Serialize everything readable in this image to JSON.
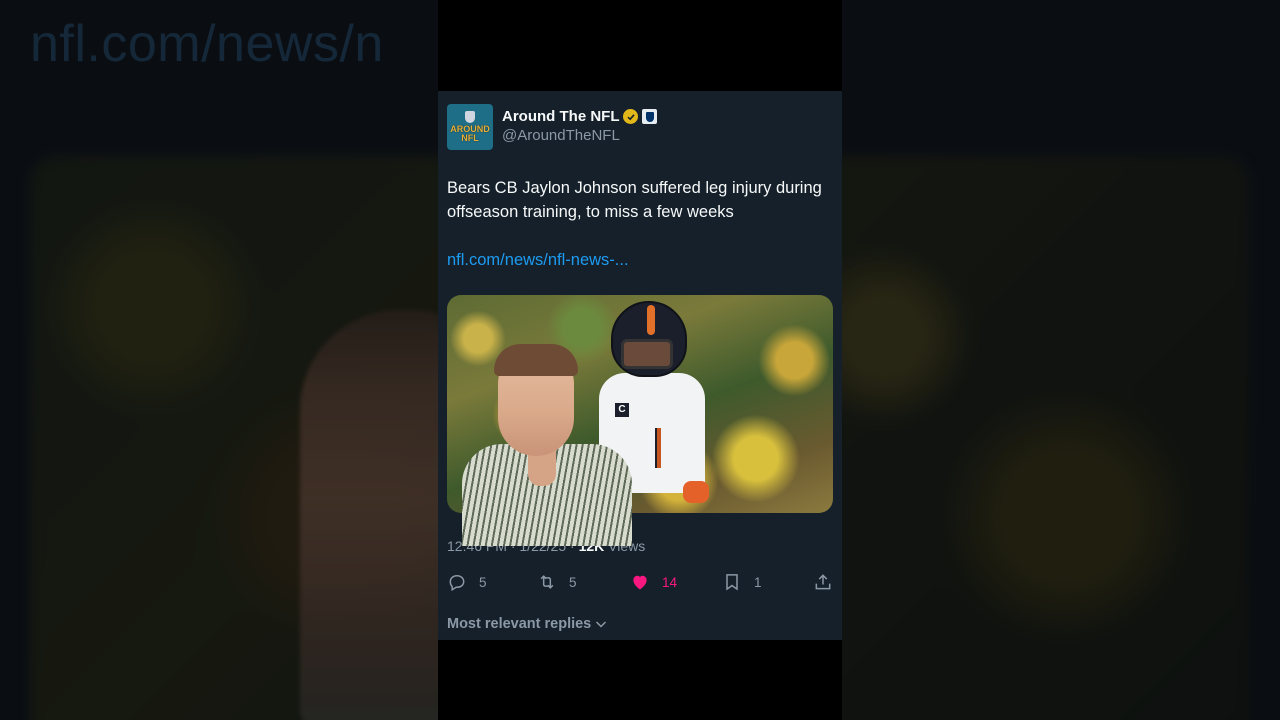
{
  "background": {
    "url_text": "nfl.com/news/n"
  },
  "tweet": {
    "display_name": "Around The NFL",
    "handle": "@AroundTheNFL",
    "avatar_text": "AROUND NFL",
    "text": "Bears CB Jaylon Johnson suffered leg injury during offseason training, to miss a few weeks",
    "link": "nfl.com/news/nfl-news-...",
    "time": "12:46 PM",
    "date": "1/22/25",
    "views_count": "12K",
    "views_label": "Views",
    "separator": "·",
    "actions": {
      "replies": "5",
      "reposts": "5",
      "likes": "14",
      "bookmarks": "1"
    },
    "replies_sort_label": "Most relevant replies"
  },
  "colors": {
    "background": "#15202b",
    "link": "#1d9bf0",
    "like": "#f91880",
    "verified": "#e2b719",
    "secondary_text": "#8b98a5"
  },
  "icons": [
    "verified-badge-icon",
    "nfl-affiliation-icon",
    "reply-icon",
    "repost-icon",
    "like-heart-icon",
    "bookmark-icon",
    "share-icon",
    "chevron-down-icon"
  ]
}
